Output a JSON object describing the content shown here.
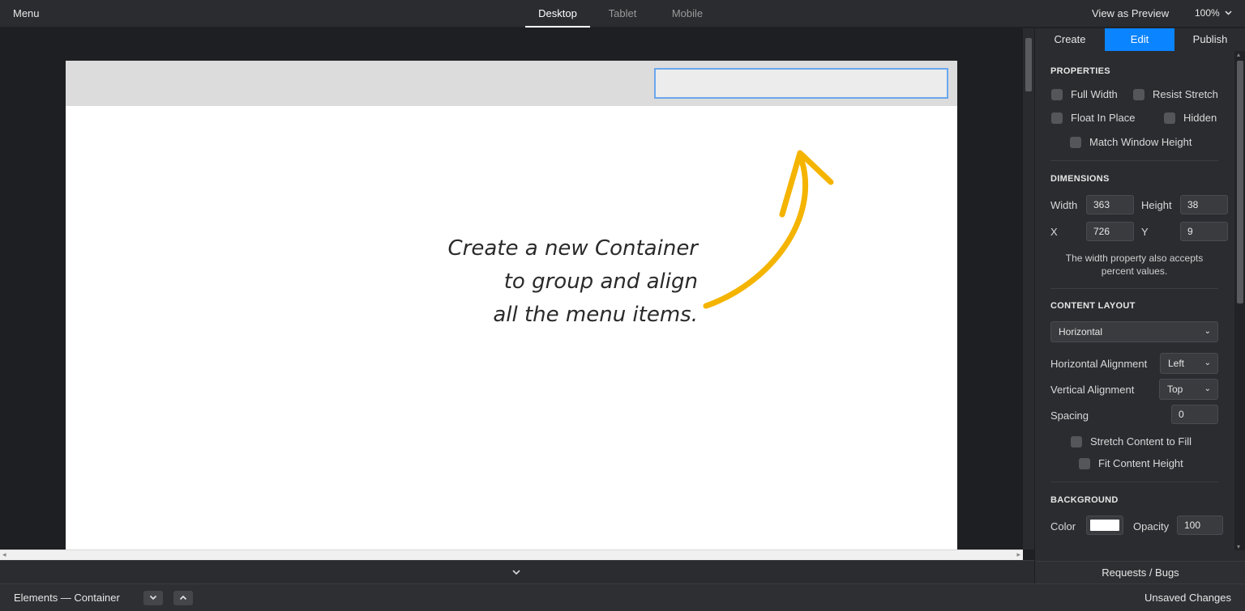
{
  "topbar": {
    "menu": "Menu",
    "device_tabs": [
      "Desktop",
      "Tablet",
      "Mobile"
    ],
    "active_device": "Desktop",
    "view_as_preview": "View as Preview",
    "zoom": "100%"
  },
  "canvas": {
    "annotation": "Create a new Container\nto group and align\nall the menu items.",
    "accent_color": "#f4b400",
    "selection_color": "#6aa7ee"
  },
  "panel": {
    "tabs": [
      "Create",
      "Edit",
      "Publish"
    ],
    "active_tab": "Edit",
    "properties": {
      "title": "PROPERTIES",
      "full_width": "Full Width",
      "resist_stretch": "Resist Stretch",
      "float_in_place": "Float In Place",
      "hidden": "Hidden",
      "match_window_height": "Match Window Height"
    },
    "dimensions": {
      "title": "DIMENSIONS",
      "width_label": "Width",
      "width_value": "363",
      "height_label": "Height",
      "height_value": "38",
      "x_label": "X",
      "x_value": "726",
      "y_label": "Y",
      "y_value": "9",
      "note": "The width property also accepts percent values."
    },
    "content_layout": {
      "title": "CONTENT LAYOUT",
      "layout_value": "Horizontal",
      "h_align_label": "Horizontal Alignment",
      "h_align_value": "Left",
      "v_align_label": "Vertical Alignment",
      "v_align_value": "Top",
      "spacing_label": "Spacing",
      "spacing_value": "0",
      "stretch_content": "Stretch Content to Fill",
      "fit_content_height": "Fit Content Height"
    },
    "background": {
      "title": "BACKGROUND",
      "color_label": "Color",
      "color_value": "#ffffff",
      "opacity_label": "Opacity",
      "opacity_value": "100"
    },
    "requests": "Requests / Bugs"
  },
  "statusbar": {
    "breadcrumb": "Elements — Container",
    "unsaved": "Unsaved Changes"
  }
}
